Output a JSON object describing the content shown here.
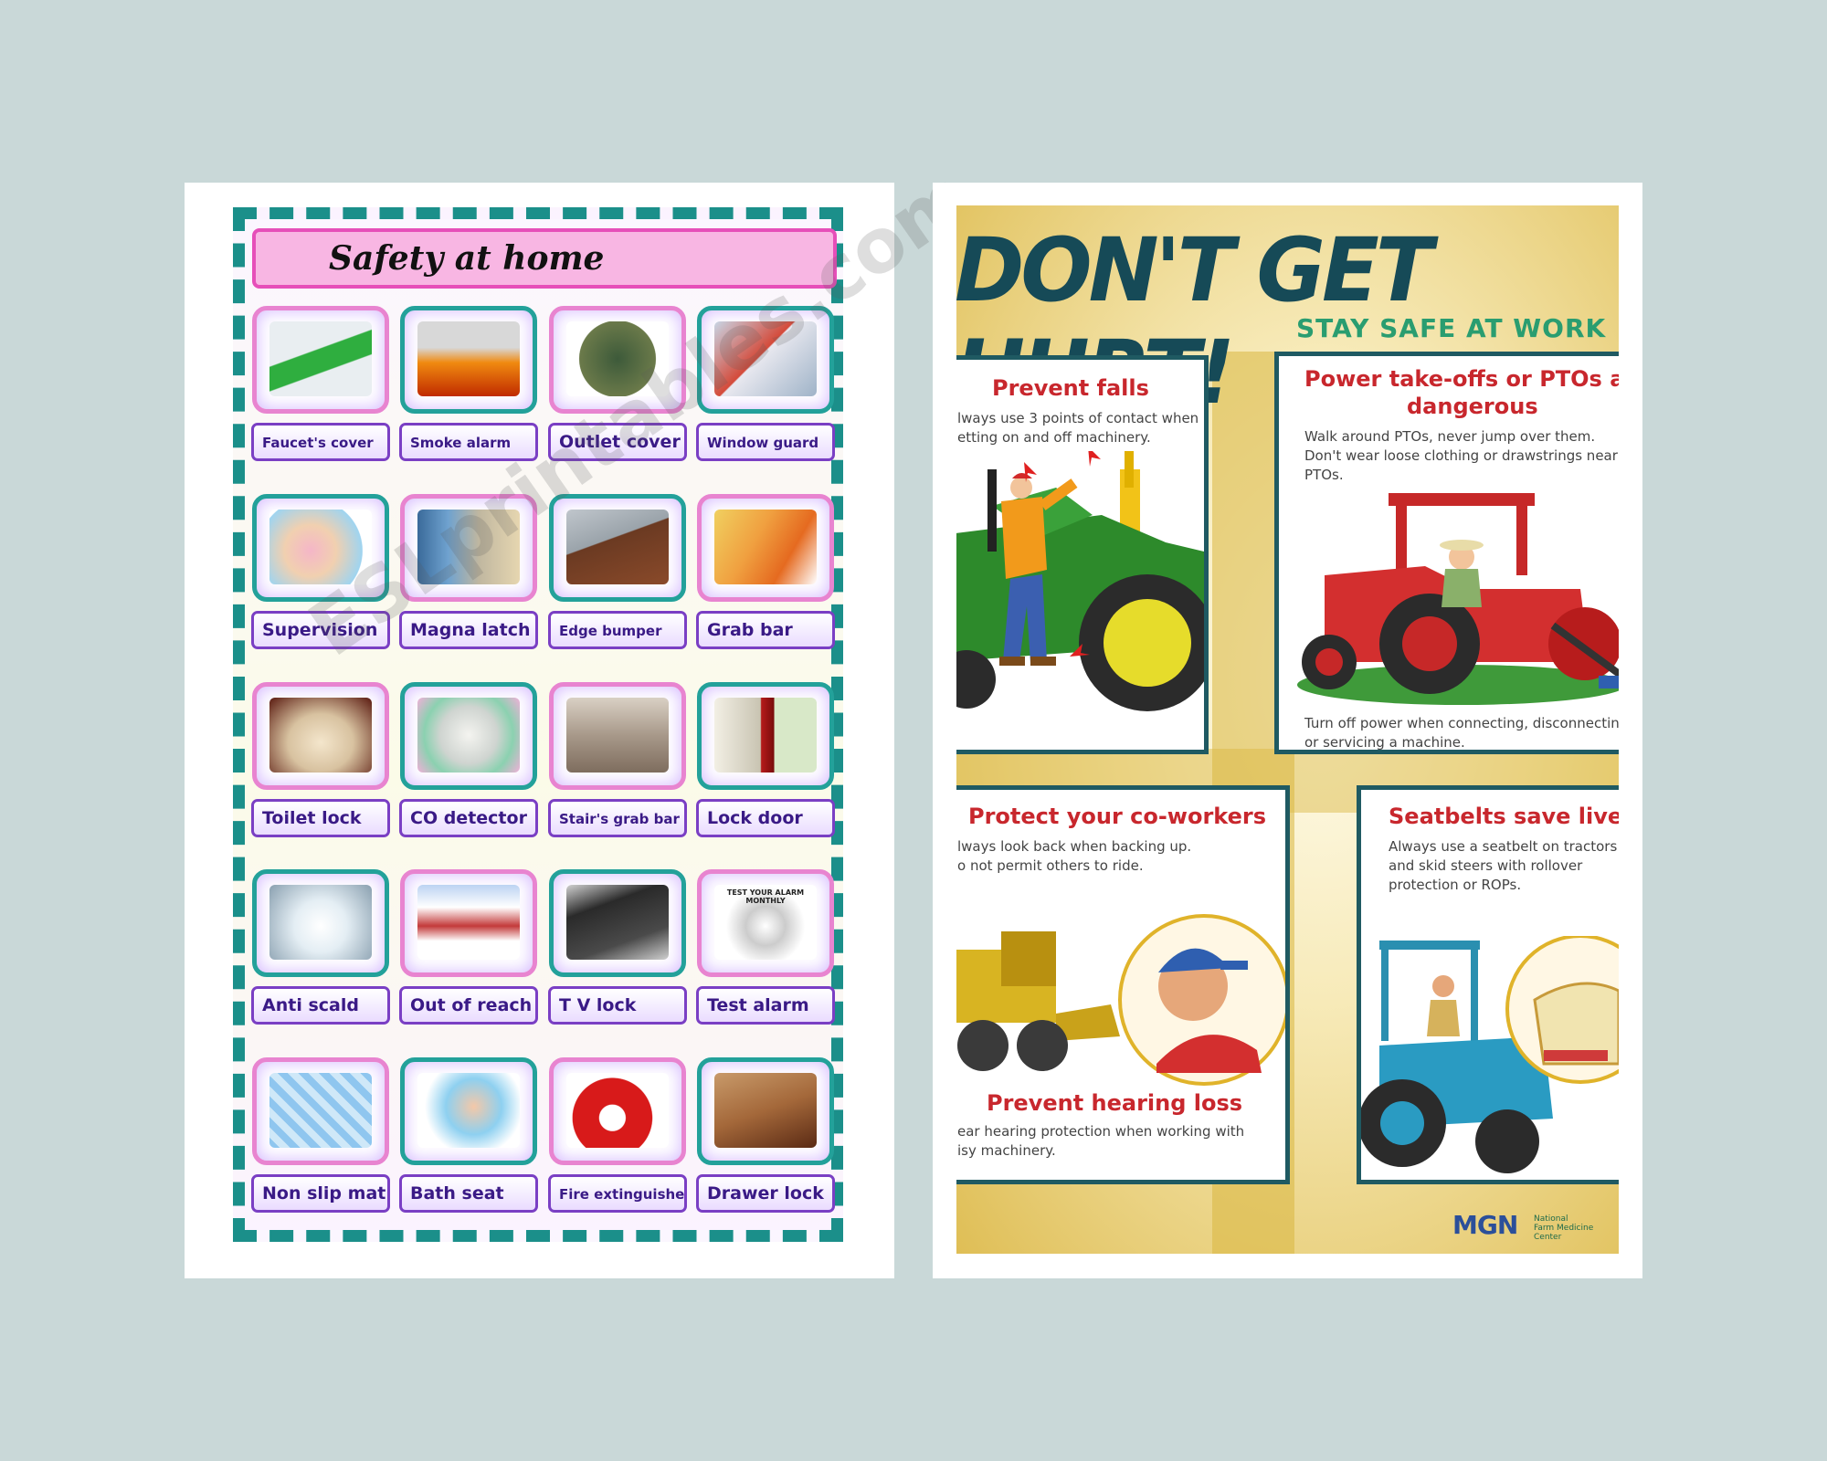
{
  "worksheet": {
    "title": "Safety at home",
    "watermark": "ESLprintables.com",
    "items": [
      {
        "label": "Faucet's cover",
        "icon": "frog-faucet-cover-icon"
      },
      {
        "label": "Smoke alarm",
        "icon": "smoke-alarm-icon"
      },
      {
        "label": "Outlet cover",
        "icon": "outlet-cover-icon"
      },
      {
        "label": "Window guard",
        "icon": "window-guard-icon"
      },
      {
        "label": "Supervision",
        "icon": "bath-supervision-icon"
      },
      {
        "label": "Magna latch",
        "icon": "magna-latch-icon"
      },
      {
        "label": "Edge bumper",
        "icon": "edge-bumper-icon"
      },
      {
        "label": "Grab bar",
        "icon": "grab-bar-icon"
      },
      {
        "label": "Toilet lock",
        "icon": "toilet-lock-icon"
      },
      {
        "label": "CO detector",
        "icon": "co-detector-icon"
      },
      {
        "label": "Stair's grab bar",
        "icon": "stair-grab-bar-icon"
      },
      {
        "label": "Lock door",
        "icon": "door-lock-icon"
      },
      {
        "label": "Anti scald",
        "icon": "anti-scald-icon"
      },
      {
        "label": "Out of reach",
        "icon": "out-of-reach-icon"
      },
      {
        "label": "T V lock",
        "icon": "tv-lock-icon"
      },
      {
        "label": "Test alarm",
        "icon": "test-alarm-icon"
      },
      {
        "label": "Non slip mat",
        "icon": "non-slip-mat-icon"
      },
      {
        "label": "Bath seat",
        "icon": "bath-seat-icon"
      },
      {
        "label": "Fire extinguisher",
        "icon": "fire-extinguisher-icon"
      },
      {
        "label": "Drawer lock",
        "icon": "drawer-lock-icon"
      }
    ],
    "alarm_card_text": "TEST YOUR ALARM MONTHLY"
  },
  "poster": {
    "title": "DON'T GET HURT!",
    "subtitle": "STAY SAFE AT WORK",
    "panels": {
      "falls": {
        "heading": "Prevent falls",
        "line1": "lways use 3 points of contact when",
        "line2": "etting on and off machinery."
      },
      "pto": {
        "heading_line1": "Power take-offs or PTOs are",
        "heading_line2": "dangerous",
        "body1": "Walk around PTOs, never jump over them.",
        "body2": "Don't wear loose clothing or drawstrings near",
        "body3": "PTOs.",
        "footer1": "Turn off power when connecting, disconnecting",
        "footer2": "or servicing a machine."
      },
      "coworkers": {
        "heading": "Protect your co-workers",
        "line1": "lways look back when backing up.",
        "line2": "o not permit others to ride.",
        "heading2": "Prevent hearing loss",
        "line3": "ear hearing protection when working with",
        "line4": "isy machinery."
      },
      "seatbelts": {
        "heading": "Seatbelts save lives",
        "line1": "Always use a seatbelt on tractors",
        "line2": "and skid steers with rollover",
        "line3": "protection or ROPs."
      }
    },
    "logos": {
      "mgn": "MGN",
      "nfmc1": "National",
      "nfmc2": "Farm Medicine",
      "nfmc3": "Center"
    }
  }
}
